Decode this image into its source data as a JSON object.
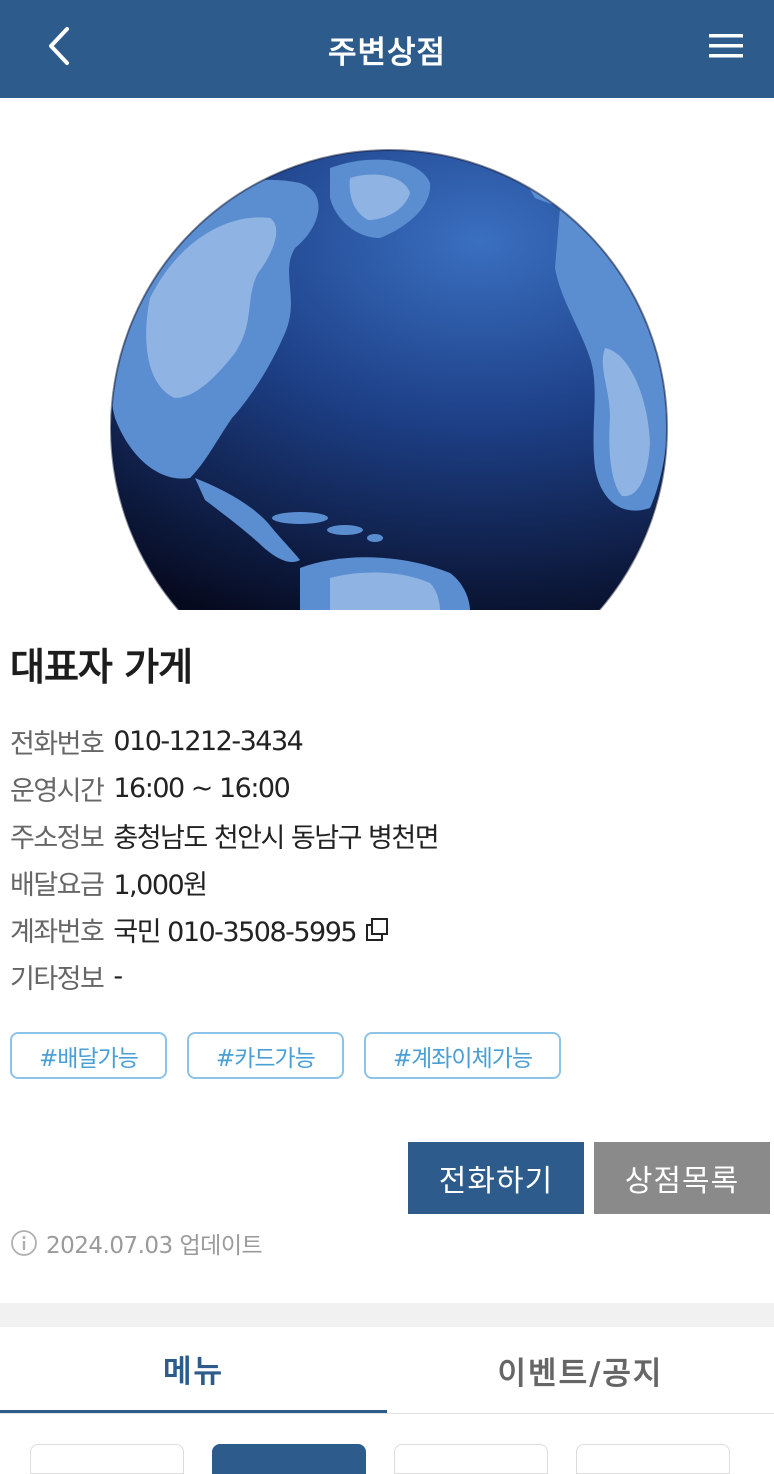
{
  "header": {
    "title": "주변상점",
    "back_icon": "chevron-left-icon",
    "menu_icon": "hamburger-menu-icon",
    "background": "#2c5b8c"
  },
  "store": {
    "name": "대표자 가게",
    "info": [
      {
        "label": "전화번호",
        "value": "010-1212-3434"
      },
      {
        "label": "운영시간",
        "value": "16:00 ~ 16:00"
      },
      {
        "label": "주소정보",
        "value": "충청남도 천안시 동남구 병천면"
      },
      {
        "label": "배달요금",
        "value": "1,000원"
      },
      {
        "label": "계좌번호",
        "value": "국민 010-3508-5995"
      },
      {
        "label": "기타정보",
        "value": "-"
      }
    ],
    "tags": [
      "#배달가능",
      "#카드가능",
      "#계좌이체가능"
    ]
  },
  "actions": {
    "call_label": "전화하기",
    "list_label": "상점목록"
  },
  "update_text": "2024.07.03 업데이트",
  "tabs": [
    {
      "label": "메뉴",
      "active": true
    },
    {
      "label": "이벤트/공지",
      "active": false
    }
  ],
  "colors": {
    "primary": "#2c5b8c",
    "tag": "#4aa0d6",
    "secondary_button": "#8a8a8a"
  }
}
